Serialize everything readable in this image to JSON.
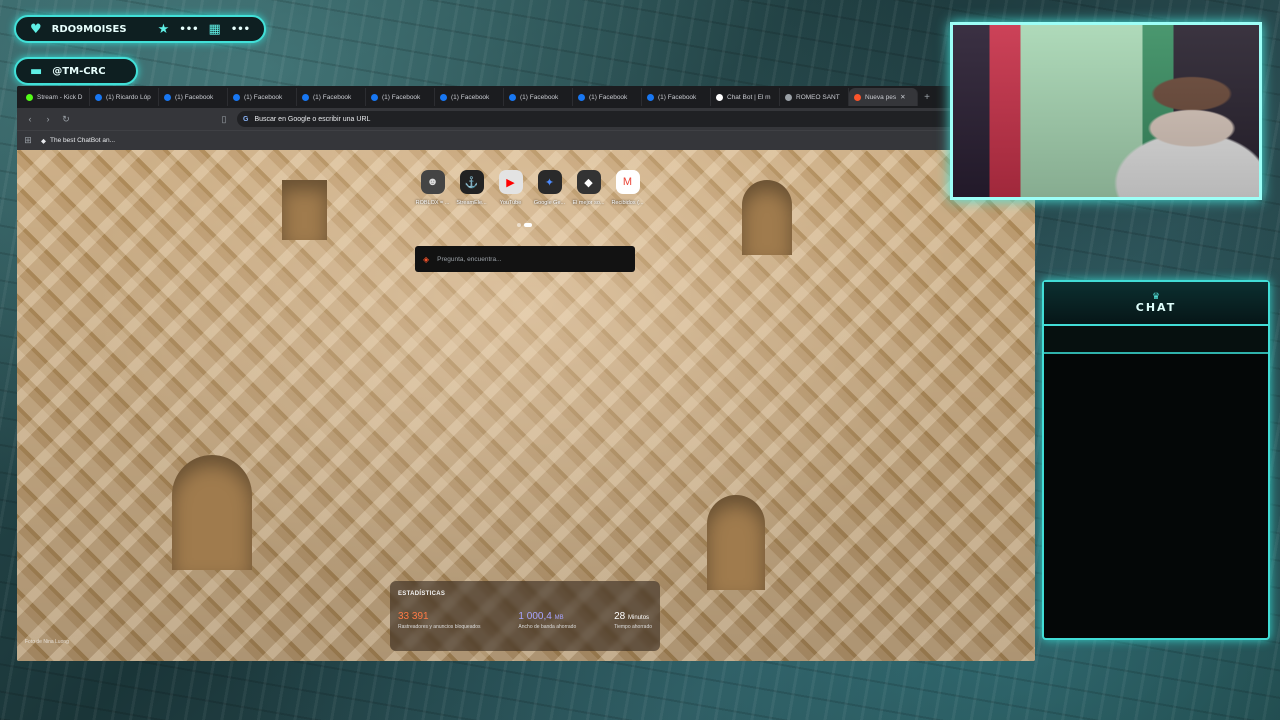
{
  "overlay": {
    "username": "RDO9MOISES",
    "pill_extra_1": "•••",
    "pill_extra_2": "•••",
    "handle": "@TM-CRC",
    "chat_title": "CHAT"
  },
  "browser": {
    "tabs": [
      {
        "label": "Stream - Kick D",
        "icon": "kick-icon",
        "color": "#53fc18"
      },
      {
        "label": "(1) Ricardo Lóp",
        "icon": "facebook-icon",
        "color": "#1877f2"
      },
      {
        "label": "(1) Facebook",
        "icon": "facebook-icon",
        "color": "#1877f2"
      },
      {
        "label": "(1) Facebook",
        "icon": "facebook-icon",
        "color": "#1877f2"
      },
      {
        "label": "(1) Facebook",
        "icon": "facebook-icon",
        "color": "#1877f2"
      },
      {
        "label": "(1) Facebook",
        "icon": "facebook-icon",
        "color": "#1877f2"
      },
      {
        "label": "(1) Facebook",
        "icon": "facebook-icon",
        "color": "#1877f2"
      },
      {
        "label": "(1) Facebook",
        "icon": "facebook-icon",
        "color": "#1877f2"
      },
      {
        "label": "(1) Facebook",
        "icon": "facebook-icon",
        "color": "#1877f2"
      },
      {
        "label": "(1) Facebook",
        "icon": "facebook-icon",
        "color": "#1877f2"
      },
      {
        "label": "Chat Bot | El m",
        "icon": "chatbot-icon",
        "color": "#ffffff"
      },
      {
        "label": "ROMEO SANT",
        "icon": "globe-icon",
        "color": "#9aa0a6"
      },
      {
        "label": "Nueva pes",
        "icon": "brave-icon",
        "color": "#fb542b"
      }
    ],
    "address_placeholder": "Buscar en Google o escribir una URL",
    "bookmark": "The best ChatBot an...",
    "shortcuts": [
      {
        "label": "ROBLOX = ...",
        "glyph": "☻"
      },
      {
        "label": "StreamEle...",
        "glyph": "⚓"
      },
      {
        "label": "YouTube",
        "glyph": "▶"
      },
      {
        "label": "Google Ge...",
        "glyph": "✦"
      },
      {
        "label": "El mejor so...",
        "glyph": "◆"
      },
      {
        "label": "Recibidos (...",
        "glyph": "M"
      }
    ],
    "search_placeholder": "Pregunta, encuentra...",
    "photo_credit": "Foto de Nina Luong",
    "stats": {
      "title": "ESTADÍSTICAS",
      "trackers_value": "33 391",
      "trackers_label": "Rastreadores y anuncios bloqueados",
      "bandwidth_value": "1 000,4",
      "bandwidth_unit": "MB",
      "bandwidth_label": "Ancho de banda ahorrado",
      "time_value": "28",
      "time_unit": "Minutos",
      "time_label": "Tiempo ahorrado"
    }
  },
  "colors": {
    "accent": "#42ddd6",
    "trackers": "#ff7a45",
    "bandwidth": "#a7a4ff",
    "time": "#ffffff"
  }
}
